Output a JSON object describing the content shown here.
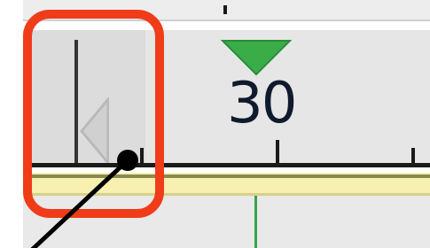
{
  "ruler": {
    "tick_labels": [
      "30"
    ],
    "playhead_color": "#3aad48"
  },
  "annotation": {
    "highlight_color": "#f03c19",
    "pointer_color": "#000000"
  }
}
